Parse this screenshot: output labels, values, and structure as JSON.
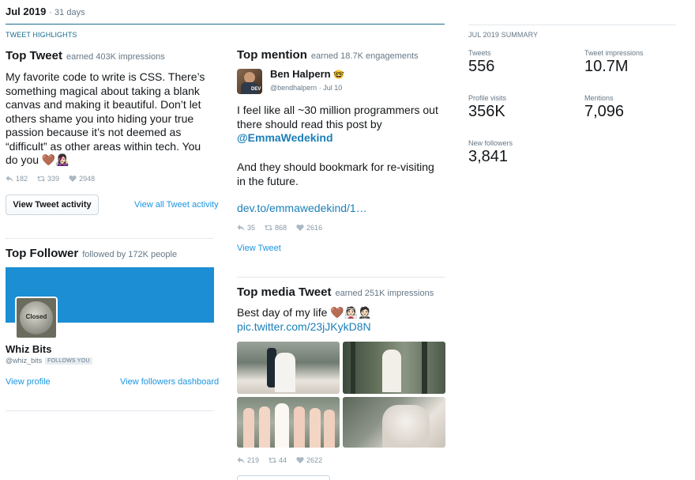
{
  "header": {
    "month": "Jul 2019",
    "days": "· 31 days",
    "highlights_label": "TWEET HIGHLIGHTS"
  },
  "top_tweet": {
    "title": "Top Tweet",
    "subtitle": "earned 403K impressions",
    "text": "My favorite code to write is CSS. There’s something magical about taking a blank canvas and making it beautiful. Don’t let others shame you into hiding your true passion because it’s not deemed as “difficult” as other areas within tech. You do you 🤎👩🏻‍🎤",
    "replies": "182",
    "retweets": "339",
    "likes": "2948",
    "view_button": "View Tweet activity",
    "view_all_link": "View all Tweet activity"
  },
  "top_follower": {
    "title": "Top Follower",
    "subtitle": "followed by 172K people",
    "name": "Whiz Bits",
    "handle": "@whiz_bits",
    "badge": "FOLLOWS YOU",
    "avatar_text": "Closed",
    "view_profile": "View profile",
    "view_dashboard": "View followers dashboard",
    "banner_color": "#1b8ed4"
  },
  "top_mention": {
    "title": "Top mention",
    "subtitle": "earned 18.7K engagements",
    "author_name": "Ben Halpern",
    "author_emoji": "🤓",
    "handle": "@bendhalpern",
    "date": "· Jul 10",
    "avatar_tag": "DEV",
    "text_line1": "I feel like all ~30 million programmers out there should read this post by",
    "mention": "@EmmaWedekind",
    "text_line2": "And they should bookmark for re-visiting in the future.",
    "url": "dev.to/emmawedekind/1…",
    "replies": "35",
    "retweets": "868",
    "likes": "2616",
    "view_link": "View Tweet"
  },
  "top_media": {
    "title": "Top media Tweet",
    "subtitle": "earned 251K impressions",
    "text": "Best day of my life 🤎👰🏻🤵🏻",
    "link": "pic.twitter.com/23jJKykD8N",
    "replies": "219",
    "retweets": "44",
    "likes": "2622"
  },
  "summary": {
    "title": "JUL 2019 SUMMARY",
    "tweets_label": "Tweets",
    "tweets_value": "556",
    "impressions_label": "Tweet impressions",
    "impressions_value": "10.7M",
    "visits_label": "Profile visits",
    "visits_value": "356K",
    "mentions_label": "Mentions",
    "mentions_value": "7,096",
    "followers_label": "New followers",
    "followers_value": "3,841"
  }
}
